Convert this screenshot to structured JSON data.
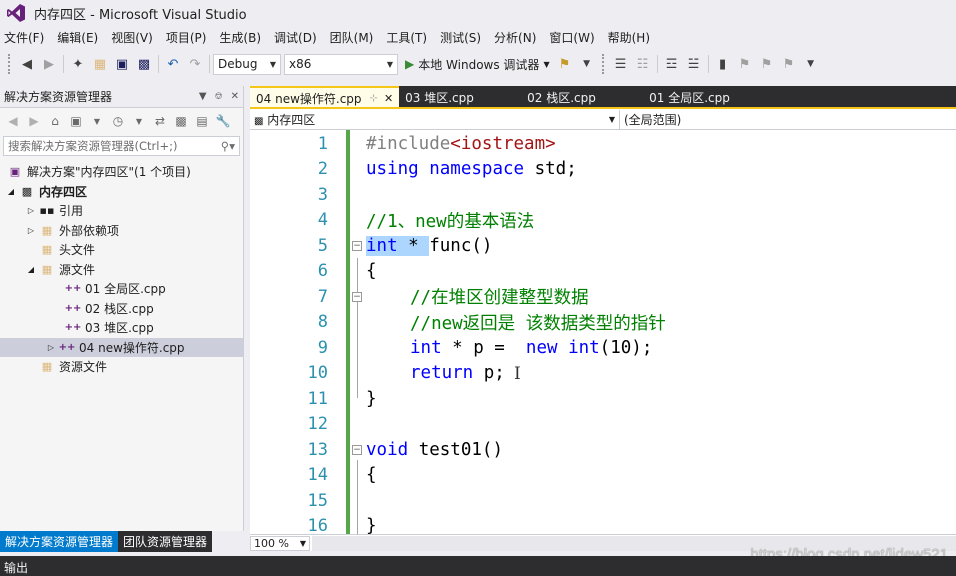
{
  "window": {
    "title": "内存四区 - Microsoft Visual Studio"
  },
  "menu": [
    "文件(F)",
    "编辑(E)",
    "视图(V)",
    "项目(P)",
    "生成(B)",
    "调试(D)",
    "团队(M)",
    "工具(T)",
    "测试(S)",
    "分析(N)",
    "窗口(W)",
    "帮助(H)"
  ],
  "toolbar": {
    "config": "Debug",
    "platform": "x86",
    "debugger_label": "本地 Windows 调试器"
  },
  "solution_explorer": {
    "title": "解决方案资源管理器",
    "search_placeholder": "搜索解决方案资源管理器(Ctrl+;)",
    "items": [
      {
        "label": "解决方案\"内存四区\"(1 个项目)"
      },
      {
        "label": "内存四区"
      },
      {
        "label": "引用"
      },
      {
        "label": "外部依赖项"
      },
      {
        "label": "头文件"
      },
      {
        "label": "源文件"
      },
      {
        "label": "01 全局区.cpp"
      },
      {
        "label": "02 栈区.cpp"
      },
      {
        "label": "03 堆区.cpp"
      },
      {
        "label": "04 new操作符.cpp"
      },
      {
        "label": "资源文件"
      }
    ],
    "tabs": [
      "解决方案资源管理器",
      "团队资源管理器"
    ]
  },
  "editor": {
    "tabs": [
      "04 new操作符.cpp",
      "03 堆区.cpp",
      "02 栈区.cpp",
      "01 全局区.cpp"
    ],
    "nav_scope": "内存四区",
    "nav_member": "(全局范围)",
    "zoom": "100 %",
    "line_numbers": [
      "1",
      "2",
      "3",
      "4",
      "5",
      "6",
      "7",
      "8",
      "9",
      "10",
      "11",
      "12",
      "13",
      "14",
      "15",
      "16"
    ],
    "code": {
      "l1_a": "#include",
      "l1_b": "<iostream>",
      "l2_a": "using",
      "l2_b": " ",
      "l2_c": "namespace",
      "l2_d": " std;",
      "l4": "//1、new的基本语法",
      "l5_a": "int",
      "l5_b": " * ",
      "l5_c": "func()",
      "l6": "{",
      "l7": "//在堆区创建整型数据",
      "l8": "//new返回是 该数据类型的指针",
      "l9_a": "int",
      "l9_b": " * p =  ",
      "l9_c": "new",
      "l9_d": " ",
      "l9_e": "int",
      "l9_f": "(10);",
      "l10_a": "return",
      "l10_b": " p;",
      "l11": "}",
      "l13_a": "void",
      "l13_b": " test01()",
      "l14": "{",
      "l16": "}"
    }
  },
  "watermark": "https://blog.csdn.net/lidew521",
  "output": {
    "label": "输出"
  }
}
